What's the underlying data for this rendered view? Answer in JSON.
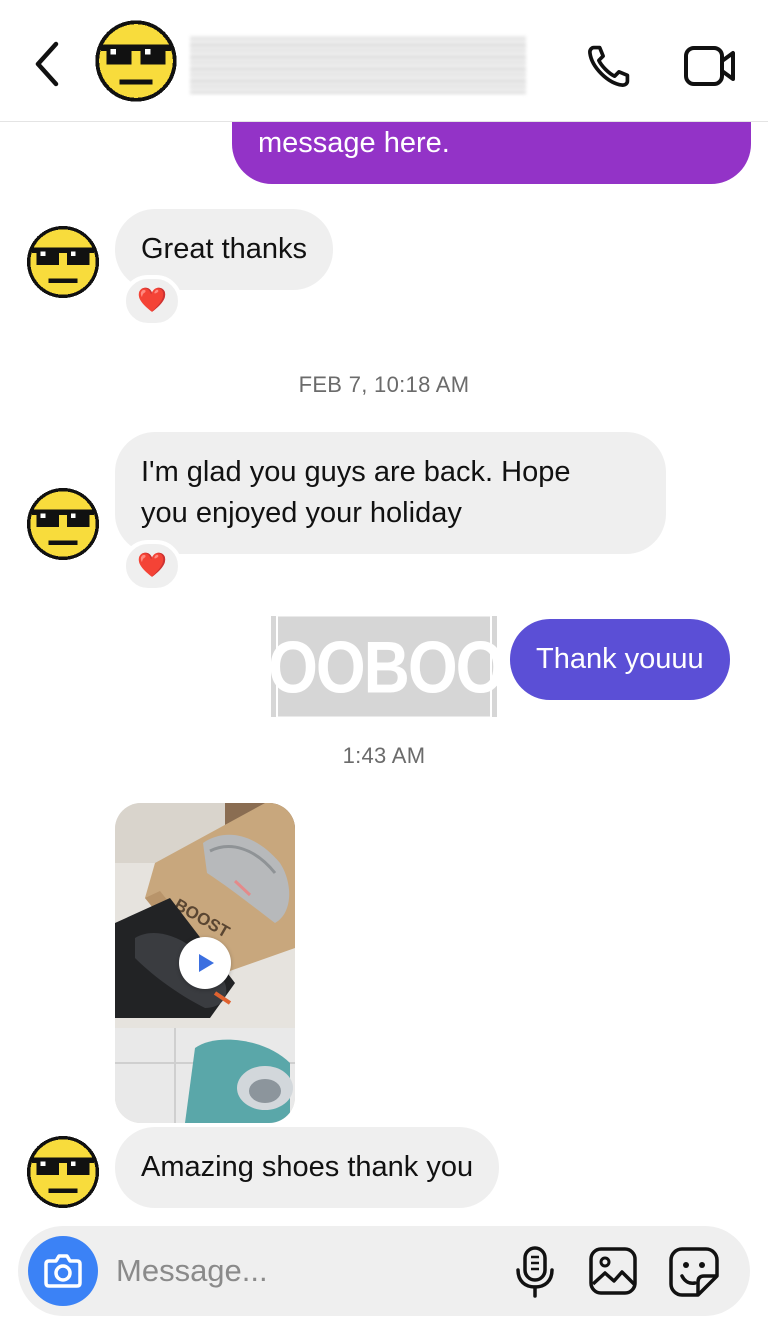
{
  "header": {
    "contact_name_blurred": true,
    "icons": [
      "back-chevron-icon",
      "contact-avatar",
      "phone-icon",
      "video-camera-icon"
    ]
  },
  "messages": [
    {
      "id": "m0",
      "direction": "outgoing",
      "text": "message here.",
      "color": "#9333c7",
      "partially_visible": true
    },
    {
      "id": "m1",
      "direction": "incoming",
      "text": "Great thanks",
      "reaction": "❤️"
    },
    {
      "id": "t1",
      "type": "timestamp",
      "text": "FEB 7, 10:18 AM"
    },
    {
      "id": "m2",
      "direction": "incoming",
      "line1": "I'm glad you guys are back. Hope",
      "line2": "you enjoyed your holiday",
      "reaction": "❤️"
    },
    {
      "id": "m3",
      "direction": "outgoing",
      "text": "Thank youuu",
      "color": "#5b4fd6"
    },
    {
      "id": "t2",
      "type": "timestamp",
      "text": "1:43 AM"
    },
    {
      "id": "m4",
      "direction": "incoming",
      "type": "video",
      "thumbnail_text": "BOOST"
    },
    {
      "id": "m5",
      "direction": "incoming",
      "text": "Amazing shoes thank you"
    }
  ],
  "watermark": {
    "text": "BOOBOOX"
  },
  "composer": {
    "placeholder": "Message...",
    "accent": "#3b82f6",
    "icons": [
      "camera-icon",
      "microphone-icon",
      "gallery-icon",
      "sticker-icon"
    ]
  }
}
